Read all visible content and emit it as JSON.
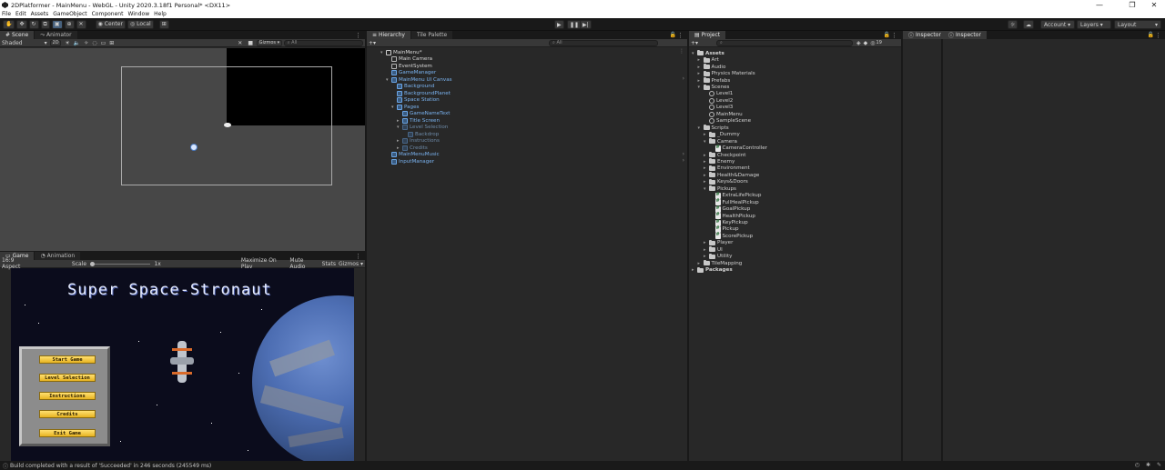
{
  "window": {
    "title": "2DPlatformer - MainMenu - WebGL - Unity 2020.3.18f1 Personal* <DX11>",
    "minimize": "—",
    "maximize": "❐",
    "close": "✕"
  },
  "menubar": [
    "File",
    "Edit",
    "Assets",
    "GameObject",
    "Component",
    "Window",
    "Help"
  ],
  "toolbar": {
    "pivot_label": "Center",
    "space_label": "Local",
    "account_label": "Account",
    "layers_label": "Layers",
    "layout_label": "Layout"
  },
  "scene_panel": {
    "tabs": [
      "Scene",
      "Animator"
    ],
    "shading_mode": "Shaded",
    "mode_2d": "2D",
    "gizmos_label": "Gizmos",
    "search_placeholder": "All"
  },
  "game_panel": {
    "tabs": [
      "Game",
      "Animation"
    ],
    "aspect": "16:9 Aspect",
    "scale_label": "Scale",
    "scale_value": "1x",
    "maximize_label": "Maximize On Play",
    "mute_label": "Mute Audio",
    "stats_label": "Stats",
    "gizmos_label": "Gizmos",
    "game_title": "Super Space-Stronaut",
    "menu_buttons": [
      "Start Game",
      "Level Selection",
      "Instructions",
      "Credits",
      "Exit Game"
    ]
  },
  "hierarchy_panel": {
    "tabs": [
      "Hierarchy",
      "Tile Palette"
    ],
    "search_placeholder": "All",
    "items": [
      {
        "label": "MainMenu*",
        "depth": 0,
        "kind": "scene",
        "arrow": "▾"
      },
      {
        "label": "Main Camera",
        "depth": 1,
        "kind": "go",
        "arrow": ""
      },
      {
        "label": "EventSystem",
        "depth": 1,
        "kind": "go",
        "arrow": ""
      },
      {
        "label": "GameManager",
        "depth": 1,
        "kind": "prefab",
        "arrow": ""
      },
      {
        "label": "MainMenu UI Canvas",
        "depth": 1,
        "kind": "prefab",
        "arrow": "▾"
      },
      {
        "label": "Background",
        "depth": 2,
        "kind": "prefab",
        "arrow": ""
      },
      {
        "label": "BackgroundPlanet",
        "depth": 2,
        "kind": "prefab",
        "arrow": ""
      },
      {
        "label": "Space Station",
        "depth": 2,
        "kind": "prefab",
        "arrow": ""
      },
      {
        "label": "Pages",
        "depth": 2,
        "kind": "prefab",
        "arrow": "▾"
      },
      {
        "label": "GameNameText",
        "depth": 3,
        "kind": "prefab",
        "arrow": ""
      },
      {
        "label": "Title Screen",
        "depth": 3,
        "kind": "prefab",
        "arrow": "▸"
      },
      {
        "label": "Level Selection",
        "depth": 3,
        "kind": "dim",
        "arrow": "▾"
      },
      {
        "label": "Backdrop",
        "depth": 4,
        "kind": "dim",
        "arrow": ""
      },
      {
        "label": "Instructions",
        "depth": 3,
        "kind": "dim",
        "arrow": "▸"
      },
      {
        "label": "Credits",
        "depth": 3,
        "kind": "dim",
        "arrow": "▸"
      },
      {
        "label": "MainMenuMusic",
        "depth": 1,
        "kind": "prefab",
        "arrow": ""
      },
      {
        "label": "InputManager",
        "depth": 1,
        "kind": "prefab",
        "arrow": ""
      }
    ]
  },
  "project_panel": {
    "tabs": [
      "Project"
    ],
    "search_placeholder": "",
    "hidden_count": "19",
    "items": [
      {
        "label": "Assets",
        "depth": 0,
        "kind": "folder",
        "arrow": "▾",
        "bold": true
      },
      {
        "label": "Art",
        "depth": 1,
        "kind": "folder",
        "arrow": "▸"
      },
      {
        "label": "Audio",
        "depth": 1,
        "kind": "folder",
        "arrow": "▸"
      },
      {
        "label": "Physics Materials",
        "depth": 1,
        "kind": "folder",
        "arrow": "▸"
      },
      {
        "label": "Prefabs",
        "depth": 1,
        "kind": "folder",
        "arrow": "▸"
      },
      {
        "label": "Scenes",
        "depth": 1,
        "kind": "folder",
        "arrow": "▾"
      },
      {
        "label": "Level1",
        "depth": 2,
        "kind": "scene",
        "arrow": ""
      },
      {
        "label": "Level2",
        "depth": 2,
        "kind": "scene",
        "arrow": ""
      },
      {
        "label": "Level3",
        "depth": 2,
        "kind": "scene",
        "arrow": ""
      },
      {
        "label": "MainMenu",
        "depth": 2,
        "kind": "scene",
        "arrow": ""
      },
      {
        "label": "SampleScene",
        "depth": 2,
        "kind": "scene",
        "arrow": ""
      },
      {
        "label": "Scripts",
        "depth": 1,
        "kind": "folder",
        "arrow": "▾"
      },
      {
        "label": "_Dummy",
        "depth": 2,
        "kind": "folder",
        "arrow": "▸"
      },
      {
        "label": "Camera",
        "depth": 2,
        "kind": "folder",
        "arrow": "▾"
      },
      {
        "label": "CameraController",
        "depth": 3,
        "kind": "script",
        "arrow": ""
      },
      {
        "label": "Checkpoint",
        "depth": 2,
        "kind": "folder",
        "arrow": "▸"
      },
      {
        "label": "Enemy",
        "depth": 2,
        "kind": "folder",
        "arrow": "▸"
      },
      {
        "label": "Environment",
        "depth": 2,
        "kind": "folder",
        "arrow": "▸"
      },
      {
        "label": "Health&Damage",
        "depth": 2,
        "kind": "folder",
        "arrow": "▸"
      },
      {
        "label": "Keys&Doors",
        "depth": 2,
        "kind": "folder",
        "arrow": "▸"
      },
      {
        "label": "Pickups",
        "depth": 2,
        "kind": "folder",
        "arrow": "▾"
      },
      {
        "label": "ExtraLifePickup",
        "depth": 3,
        "kind": "script",
        "arrow": ""
      },
      {
        "label": "FullHealPickup",
        "depth": 3,
        "kind": "script",
        "arrow": ""
      },
      {
        "label": "GoalPickup",
        "depth": 3,
        "kind": "script",
        "arrow": ""
      },
      {
        "label": "HealthPickup",
        "depth": 3,
        "kind": "script",
        "arrow": ""
      },
      {
        "label": "KeyPickup",
        "depth": 3,
        "kind": "script",
        "arrow": ""
      },
      {
        "label": "Pickup",
        "depth": 3,
        "kind": "script",
        "arrow": ""
      },
      {
        "label": "ScorePickup",
        "depth": 3,
        "kind": "script",
        "arrow": ""
      },
      {
        "label": "Player",
        "depth": 2,
        "kind": "folder",
        "arrow": "▸"
      },
      {
        "label": "UI",
        "depth": 2,
        "kind": "folder",
        "arrow": "▸"
      },
      {
        "label": "Utility",
        "depth": 2,
        "kind": "folder",
        "arrow": "▸"
      },
      {
        "label": "TileMapping",
        "depth": 1,
        "kind": "folder",
        "arrow": "▸"
      },
      {
        "label": "Packages",
        "depth": 0,
        "kind": "folder",
        "arrow": "▸",
        "bold": true
      }
    ]
  },
  "inspector_panels": [
    {
      "tab": "Inspector"
    },
    {
      "tab": "Inspector"
    }
  ],
  "status": {
    "message": "Build completed with a result of 'Succeeded' in 246 seconds (245549 ms)"
  },
  "colors": {
    "editor_bg": "#282828",
    "toolbar_bg": "#191919",
    "prefab_blue": "#7ab3f0",
    "active_tool": "#46607c"
  }
}
